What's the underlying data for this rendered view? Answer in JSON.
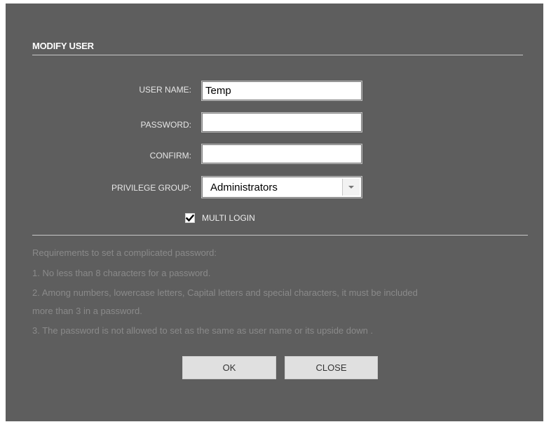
{
  "dialog": {
    "title": "MODIFY USER"
  },
  "form": {
    "username_label": "USER NAME:",
    "username_value": "Temp",
    "password_label": "PASSWORD:",
    "password_value": "",
    "confirm_label": "CONFIRM:",
    "confirm_value": "",
    "privilege_label": "PRIVILEGE GROUP:",
    "privilege_selected": "Administrators",
    "multi_login_label": "MULTI LOGIN",
    "multi_login_checked": true
  },
  "requirements": {
    "heading": "Requirements to set a complicated password:",
    "line1": "1. No less than 8 characters for a password.",
    "line2a": "2. Among numbers, lowercase letters, Capital letters and special characters, it must be included",
    "line2b": "more than 3 in a password.",
    "line3": "3. The password is not allowed to set as the same as user name or its upside down ."
  },
  "buttons": {
    "ok_label": "OK",
    "close_label": "CLOSE"
  },
  "colors": {
    "dialog_bg": "#5e5e5e",
    "button_bg": "#e0e0e0",
    "requirement_text": "#8a8a8a"
  },
  "icons": {
    "dropdown": "chevron-down-icon",
    "check": "checkmark-icon"
  }
}
